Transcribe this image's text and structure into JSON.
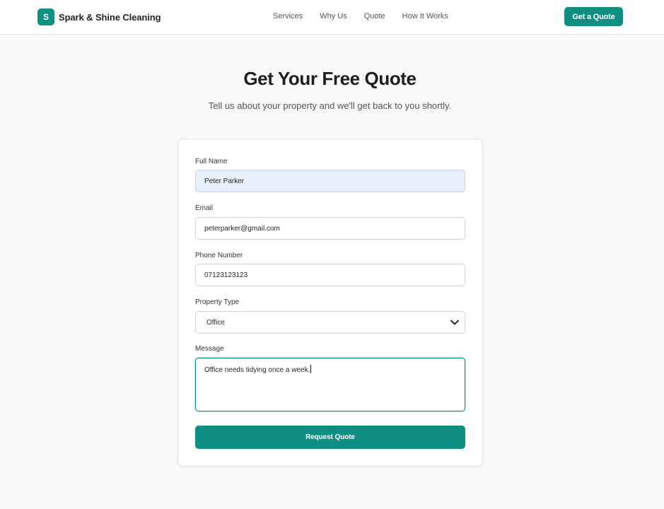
{
  "brand": {
    "logo_letter": "S",
    "name": "Spark & Shine Cleaning"
  },
  "nav": {
    "links": [
      "Services",
      "Why Us",
      "Quote",
      "How It Works"
    ],
    "cta_label": "Get a Quote"
  },
  "hero": {
    "title": "Get Your Free Quote",
    "subtitle": "Tell us about your property and we'll get back to you shortly."
  },
  "form": {
    "full_name": {
      "label": "Full Name",
      "value": "Peter Parker"
    },
    "email": {
      "label": "Email",
      "value": "peterparker@gmail.com"
    },
    "phone": {
      "label": "Phone Number",
      "value": "07123123123"
    },
    "property_type": {
      "label": "Property Type",
      "selected": "Office"
    },
    "message": {
      "label": "Message",
      "value": "Office needs tidying once a week."
    },
    "submit_label": "Request Quote"
  },
  "colors": {
    "accent": "#0f8f82",
    "autofill_bg": "#e8f0fe",
    "page_bg": "#f8f8f8"
  },
  "icons": {
    "select_arrow": "chevron-down-icon"
  }
}
